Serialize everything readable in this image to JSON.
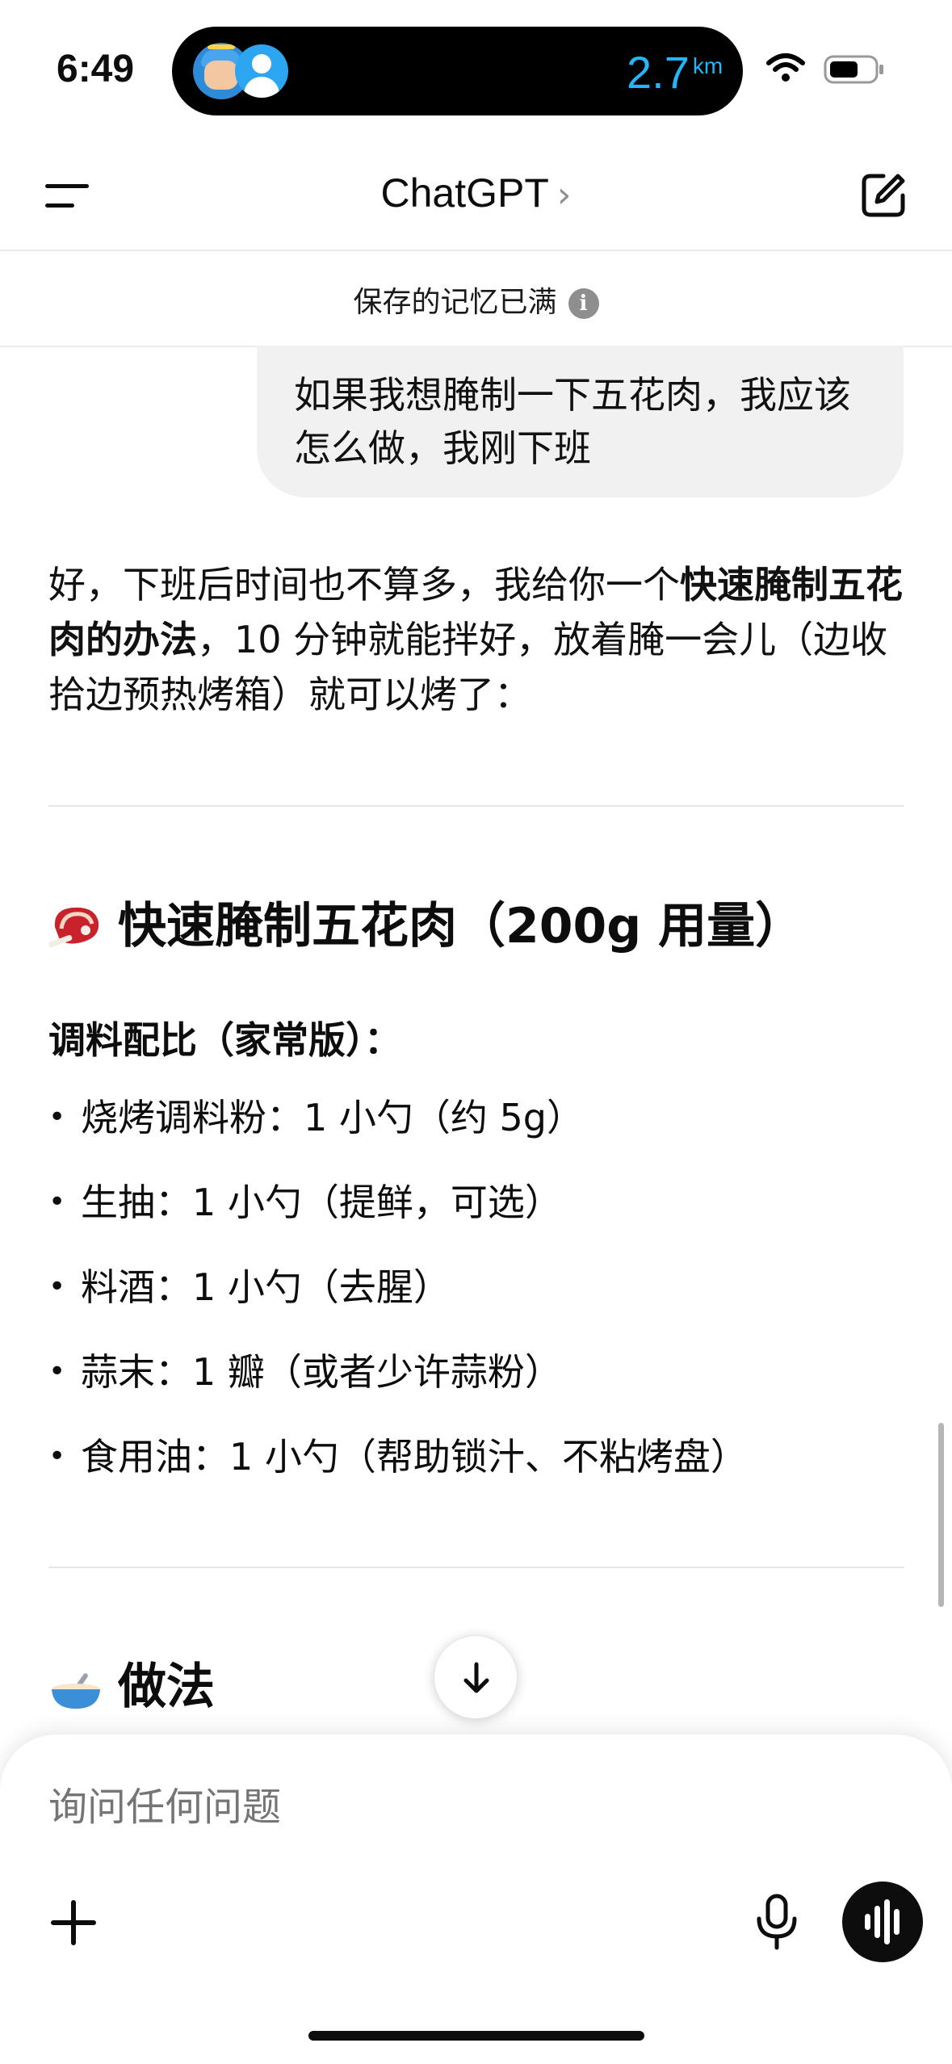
{
  "status_bar": {
    "time": "6:49",
    "distance_value": "2.7",
    "distance_unit": "km",
    "distance_color": "#23b5f5",
    "icons": [
      "wifi-icon",
      "battery-icon"
    ]
  },
  "header": {
    "title": "ChatGPT",
    "chevron": "›",
    "icons": [
      "menu-icon",
      "new-chat-icon"
    ]
  },
  "notice": {
    "text": "保存的记忆已满",
    "icon_glyph": "i"
  },
  "messages": {
    "user": "如果我想腌制一下五花肉，我应该怎么做，我刚下班",
    "intro_part1": "好，下班后时间也不算多，我给你一个",
    "intro_bold": "快速腌制五花肉的办法",
    "intro_part2": "，10 分钟就能拌好，放着腌一会儿（边收拾边预热烤箱）就可以烤了："
  },
  "section1": {
    "title": "快速腌制五花肉（200g 用量）",
    "icon": "meat-icon",
    "subheading": "调料配比（家常版）：",
    "items": [
      "烧烤调料粉：1 小勺（约 5g）",
      "生抽：1 小勺（提鲜，可选）",
      "料酒：1 小勺（去腥）",
      "蒜末：1 瓣（或者少许蒜粉）",
      "食用油：1 小勺（帮助锁汁、不粘烤盘）"
    ]
  },
  "section2": {
    "title": "做法",
    "icon": "bowl-icon"
  },
  "composer": {
    "placeholder": "询问任何问题",
    "icons": [
      "plus-icon",
      "microphone-icon",
      "voice-mode-icon"
    ]
  }
}
